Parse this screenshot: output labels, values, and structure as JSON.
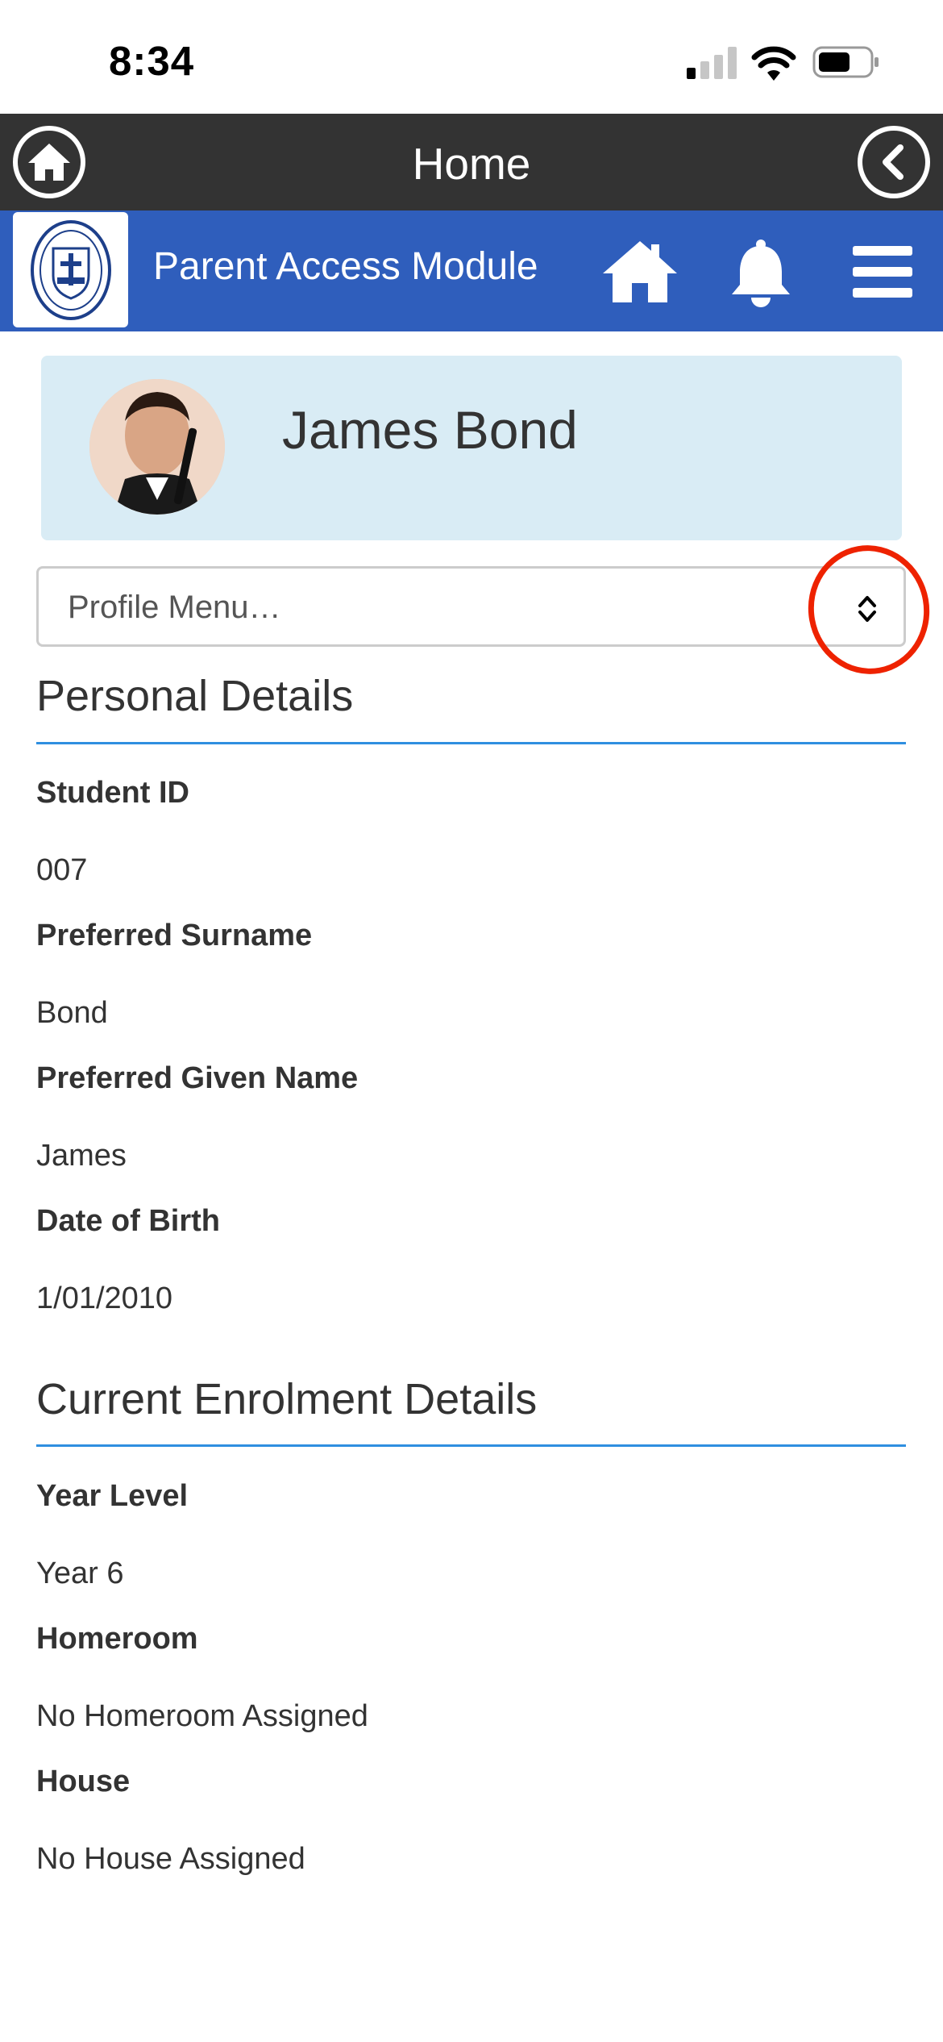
{
  "status_bar": {
    "time": "8:34"
  },
  "top_bar": {
    "title": "Home"
  },
  "module_bar": {
    "title": "Parent Access Module"
  },
  "profile": {
    "name": "James Bond"
  },
  "profile_menu": {
    "selected": "Profile Menu…"
  },
  "personal_details": {
    "heading": "Personal Details",
    "fields": [
      {
        "label": "Student ID",
        "value": "007"
      },
      {
        "label": "Preferred Surname",
        "value": "Bond"
      },
      {
        "label": "Preferred Given Name",
        "value": "James"
      },
      {
        "label": "Date of Birth",
        "value": "1/01/2010"
      }
    ]
  },
  "enrolment_details": {
    "heading": "Current Enrolment Details",
    "fields": [
      {
        "label": "Year Level",
        "value": "Year 6"
      },
      {
        "label": "Homeroom",
        "value": "No Homeroom Assigned"
      },
      {
        "label": "House",
        "value": "No House Assigned"
      }
    ]
  },
  "icons": {
    "top_left": "home-circle-icon",
    "top_right": "back-circle-icon",
    "nav": [
      "home-icon",
      "bell-icon",
      "menu-icon"
    ]
  },
  "colors": {
    "top_bar": "#333333",
    "module_bar": "#2f5ebc",
    "profile_card": "#d9ecf5",
    "section_rule": "#2f8fe0",
    "annotation": "#ee2200"
  }
}
